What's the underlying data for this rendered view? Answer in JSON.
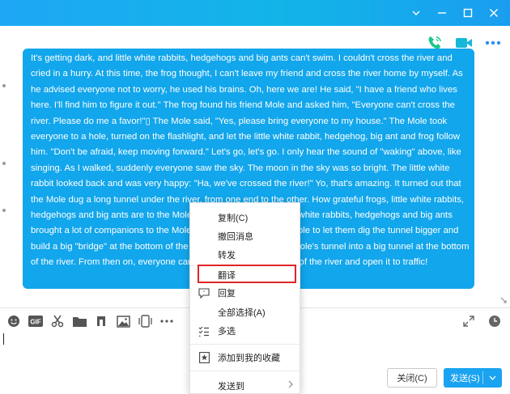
{
  "window": {
    "controls": [
      "chevron-down-icon",
      "minimize-icon",
      "maximize-icon",
      "close-icon"
    ]
  },
  "header_actions": [
    "voice-call-icon",
    "video-call-icon",
    "more-icon"
  ],
  "message": {
    "text_before": "It's getting dark, and little white rabbits, hedgehogs and big ants can't swim. I couldn't cross the river and cried in a hurry. At this time, the frog thought, I can't leave my friend and cross the river home by myself. As he advised everyone not to worry, he used his brains. Oh, here we are! He said, \"I have a friend who lives here. I'll find him to figure it out.\" The frog found his friend Mole and asked him, \"Everyone can't cross the river. Please do me a favor!\"",
    "glyph": "▯",
    "text_after": "       The Mole said, \"Yes, please bring everyone to my house.\" The Mole took everyone to a hole, turned on the flashlight, and let the little white rabbit, hedgehog, big ant and frog follow him. \"Don't be afraid, keep moving forward.\" Let's go, let's go. I only hear the sound of \"waking\" above, like singing. As I walked, suddenly everyone saw the sky. The moon in the sky was so bright. The little white rabbit looked back and was very happy: \"Ha, we've crossed the river!\" Yo, that's amazing. It turned out that the Mole dug a long tunnel under the river, from one end to the other. How grateful frogs, little white rabbits, hedgehogs and big ants are to the Mole! The next day, frogs, little white rabbits, hedgehogs and big ants brought a lot of companions to the Mole's house, and asked the Mole to let them dig the tunnel bigger and build a big \"bridge\" at the bottom of the river.       Soon, they dug the Mole's tunnel into a big tunnel at the bottom of the river. From then on, everyone can cross through the bottom of the river and open it to traffic!"
  },
  "context_menu": {
    "items": [
      {
        "label": "复制(C)",
        "icon": ""
      },
      {
        "label": "撤回消息",
        "icon": ""
      },
      {
        "label": "转发",
        "icon": ""
      },
      {
        "label": "翻译",
        "icon": ""
      },
      {
        "label": "回复",
        "icon": "quote-icon"
      },
      {
        "label": "全部选择(A)",
        "icon": ""
      },
      {
        "label": "多选",
        "icon": "checklist-icon"
      },
      {
        "label": "添加到我的收藏",
        "icon": "star-bookmark-icon"
      },
      {
        "label": "发送到",
        "icon": "",
        "submenu": true
      }
    ],
    "highlighted": "翻译",
    "highlight_color": "#e02525"
  },
  "toolbar": {
    "left_icons": [
      "emoji-icon",
      "gif-icon",
      "scissors-icon",
      "folder-icon",
      "music-icon",
      "image-icon",
      "phone-screen-icon",
      "more-dots-icon"
    ],
    "right_icons": [
      "expand-icon",
      "history-clock-icon"
    ],
    "gif_label": "GIF"
  },
  "buttons": {
    "close_label": "关闭(C)",
    "send_label": "发送(S)"
  },
  "colors": {
    "titlebar": "#1ea7f5",
    "selection": "#12a6ec",
    "send_button": "#1aa3f0",
    "call_green": "#1bc78a",
    "video_teal": "#17b7d8",
    "more_blue": "#2e8ef0"
  }
}
